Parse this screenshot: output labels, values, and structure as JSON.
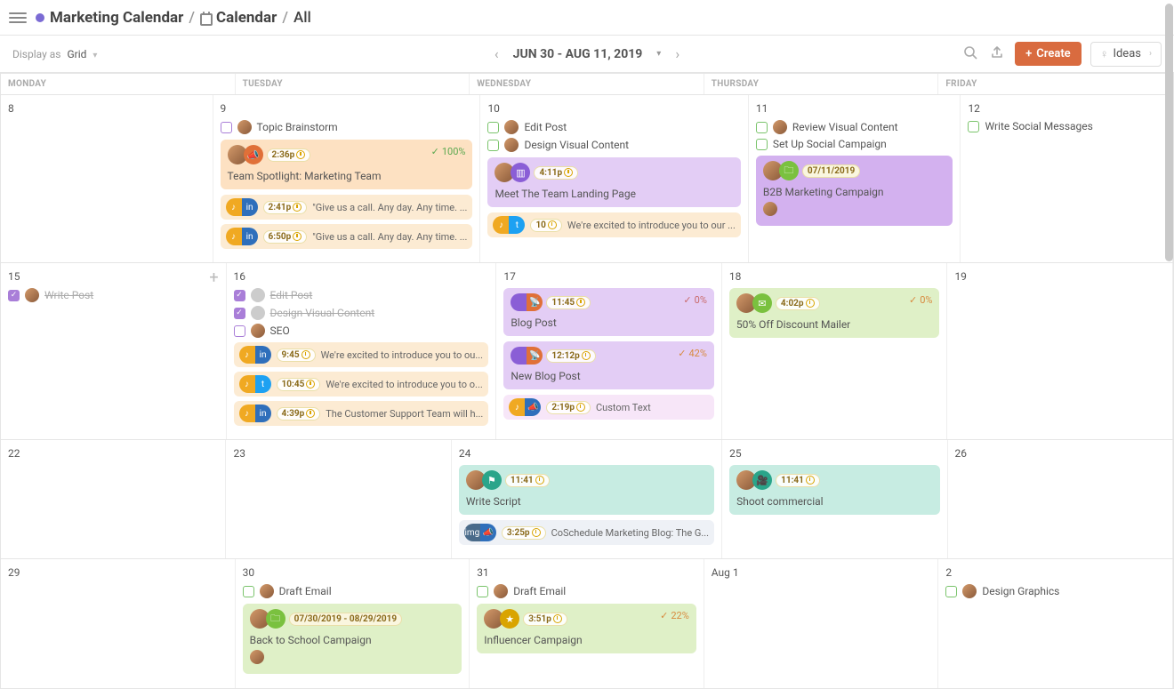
{
  "breadcrumb": {
    "workspace": "Marketing Calendar",
    "section": "Calendar",
    "filter": "All"
  },
  "toolbar": {
    "display_label": "Display as",
    "display_value": "Grid",
    "date_range": "JUN 30 - AUG 11, 2019",
    "create": "Create",
    "ideas": "Ideas"
  },
  "days": [
    "MONDAY",
    "TUESDAY",
    "WEDNESDAY",
    "THURSDAY",
    "FRIDAY"
  ],
  "weeks": [
    {
      "cells": [
        {
          "d": "8"
        },
        {
          "d": "9",
          "tasks": [
            {
              "cb": "purple",
              "av": true,
              "label": "Topic Brainstorm"
            }
          ],
          "cards": [
            {
              "theme": "c-orange",
              "av": true,
              "icon": {
                "bg": "#e07038",
                "glyph": "📣"
              },
              "time": "2:36p",
              "title": "Team Spotlight: Marketing Team",
              "pct": "100%",
              "pcls": "green"
            }
          ],
          "bars": [
            {
              "theme": "c-orange-lt",
              "dual": [
                "#f0a922",
                "#2f6fbb"
              ],
              "glyphs": [
                "♪",
                "in"
              ],
              "time": "2:41p",
              "clock": true,
              "text": "\"Give us a call. Any day. Any time. ..."
            },
            {
              "theme": "c-orange-lt",
              "dual": [
                "#f0a922",
                "#2f6fbb"
              ],
              "glyphs": [
                "♪",
                "in"
              ],
              "time": "6:50p",
              "clock": true,
              "text": "\"Give us a call. Any day. Any time. ..."
            }
          ]
        },
        {
          "d": "10",
          "tasks": [
            {
              "cb": "green",
              "av": true,
              "label": "Edit Post"
            },
            {
              "cb": "green",
              "av": true,
              "label": "Design Visual Content"
            }
          ],
          "bars": [
            {
              "theme": "c-orange-lt",
              "dual": [
                "#f0a922",
                "#1da1f2"
              ],
              "glyphs": [
                "♪",
                "t"
              ],
              "time": "10",
              "clock": true,
              "text": "We're excited to introduce you to our ..."
            }
          ],
          "cards": [
            {
              "theme": "c-purple",
              "av": true,
              "icon": {
                "bg": "#8a5ed6",
                "glyph": "▥"
              },
              "time": "4:11p",
              "title": "Meet The Team Landing Page"
            }
          ]
        },
        {
          "d": "11",
          "tasks": [
            {
              "cb": "green",
              "av": true,
              "label": "Review Visual Content"
            },
            {
              "cb": "green",
              "label": "Set Up Social Campaign"
            }
          ],
          "cards": [
            {
              "theme": "c-purple-dk",
              "av": true,
              "icon": {
                "bg": "#7ac13f",
                "glyph": "🗀"
              },
              "time": "07/11/2019",
              "plainchip": true,
              "title": "B2B Marketing Campaign",
              "avbelow": true
            }
          ]
        },
        {
          "d": "12",
          "tasks": [
            {
              "cb": "green",
              "label": "Write Social Messages"
            }
          ]
        }
      ]
    },
    {
      "cells": [
        {
          "d": "15",
          "hover": true,
          "tasks": [
            {
              "cb": "checked",
              "av": true,
              "label": "Write Post",
              "done": true
            }
          ]
        },
        {
          "d": "16",
          "tasks": [
            {
              "cb": "checked",
              "avblank": true,
              "label": "Edit Post",
              "done": true
            },
            {
              "cb": "checked",
              "avblank": true,
              "label": "Design Visual Content",
              "done": true
            },
            {
              "cb": "purple",
              "av": true,
              "label": "SEO"
            }
          ],
          "bars": [
            {
              "theme": "c-orange-lt",
              "dual": [
                "#f0a922",
                "#2f6fbb"
              ],
              "glyphs": [
                "♪",
                "in"
              ],
              "time": "9:45",
              "clock": true,
              "text": "We're excited to introduce you to ou..."
            },
            {
              "theme": "c-orange-lt",
              "dual": [
                "#f0a922",
                "#1da1f2"
              ],
              "glyphs": [
                "♪",
                "t"
              ],
              "time": "10:45",
              "clock": true,
              "text": "We're excited to introduce you to o..."
            },
            {
              "theme": "c-orange-lt",
              "dual": [
                "#f0a922",
                "#2f6fbb"
              ],
              "glyphs": [
                "♪",
                "in"
              ],
              "time": "4:39p",
              "clock": true,
              "text": "The Customer Support Team will h..."
            }
          ]
        },
        {
          "d": "17",
          "cards": [
            {
              "theme": "c-purple",
              "dual": [
                "#8a5ed6",
                "#e07038"
              ],
              "glyphs": [
                "",
                "📡"
              ],
              "time": "11:45",
              "title": "Blog Post",
              "pct": "0%",
              "pcls": "red"
            },
            {
              "theme": "c-purple",
              "dual": [
                "#8a5ed6",
                "#e07038"
              ],
              "glyphs": [
                "",
                "📡"
              ],
              "time": "12:12p",
              "title": "New Blog Post",
              "pct": "42%",
              "pcls": "orange"
            }
          ],
          "bars": [
            {
              "theme": "c-pink",
              "dual": [
                "#f0a922",
                "#2f6fbb"
              ],
              "glyphs": [
                "♪",
                "📣"
              ],
              "time": "2:19p",
              "clock": true,
              "text": "Custom Text"
            }
          ]
        },
        {
          "d": "18",
          "cards": [
            {
              "theme": "c-green",
              "av": true,
              "icon": {
                "bg": "#7ac13f",
                "glyph": "✉"
              },
              "time": "4:02p",
              "title": "50% Off Discount Mailer",
              "pct": "0%",
              "pcls": "orange"
            }
          ]
        },
        {
          "d": "19"
        }
      ]
    },
    {
      "cells": [
        {
          "d": "22"
        },
        {
          "d": "23"
        },
        {
          "d": "24",
          "cards": [
            {
              "theme": "c-teal",
              "av": true,
              "icon": {
                "bg": "#2aa58a",
                "glyph": "⚑"
              },
              "time": "11:41",
              "title": "Write Script"
            }
          ],
          "bars": [
            {
              "theme": "c-grey",
              "pilldual": true,
              "dual": [
                "#4a6b8a",
                "#2f6fbb"
              ],
              "glyphs": [
                "img",
                "📣"
              ],
              "time": "3:25p",
              "clock": true,
              "text": "CoSchedule Marketing Blog: The G..."
            }
          ]
        },
        {
          "d": "25",
          "cards": [
            {
              "theme": "c-teal",
              "av": true,
              "icon": {
                "bg": "#2aa58a",
                "glyph": "🎥"
              },
              "time": "11:41",
              "title": "Shoot commercial"
            }
          ]
        },
        {
          "d": "26"
        }
      ]
    },
    {
      "cells": [
        {
          "d": "29"
        },
        {
          "d": "30",
          "tasks": [
            {
              "cb": "green",
              "av": true,
              "label": "Draft Email"
            }
          ],
          "cards": [
            {
              "theme": "c-green",
              "av": true,
              "icon": {
                "bg": "#7ac13f",
                "glyph": "🗀"
              },
              "time": "07/30/2019 - 08/29/2019",
              "plainchip": true,
              "title": "Back to School Campaign",
              "avbelow": true
            }
          ]
        },
        {
          "d": "31",
          "tasks": [
            {
              "cb": "green",
              "av": true,
              "label": "Draft Email"
            }
          ],
          "cards": [
            {
              "theme": "c-green",
              "av": true,
              "icon": {
                "bg": "#d9a400",
                "glyph": "★"
              },
              "time": "3:51p",
              "title": "Influencer Campaign",
              "pct": "22%",
              "pcls": "orange"
            }
          ]
        },
        {
          "d": "Aug 1"
        },
        {
          "d": "2",
          "tasks": [
            {
              "cb": "green",
              "av": true,
              "label": "Design Graphics"
            }
          ]
        }
      ]
    }
  ]
}
